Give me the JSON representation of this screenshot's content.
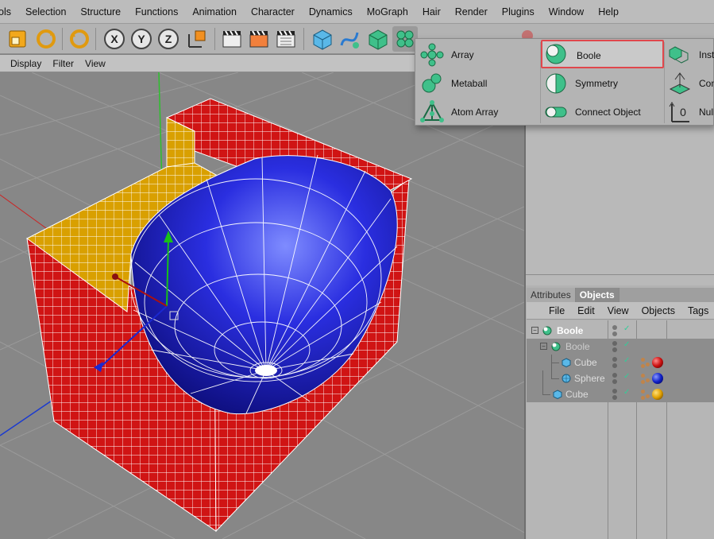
{
  "menubar": [
    "ols",
    "Selection",
    "Structure",
    "Functions",
    "Animation",
    "Character",
    "Dynamics",
    "MoGraph",
    "Hair",
    "Render",
    "Plugins",
    "Window",
    "Help"
  ],
  "viewport_menu": [
    "Display",
    "Filter",
    "View"
  ],
  "tabs": [
    {
      "label": "Attributes",
      "active": false
    },
    {
      "label": "Objects",
      "active": true
    }
  ],
  "objects_menu": [
    "File",
    "Edit",
    "View",
    "Objects",
    "Tags"
  ],
  "object_tree": [
    {
      "name": "Boole",
      "icon": "boole-icon",
      "level": 0,
      "selected": false,
      "materials": []
    },
    {
      "name": "Boole",
      "icon": "boole-icon",
      "level": 1,
      "selected": true,
      "materials": []
    },
    {
      "name": "Cube",
      "icon": "cube-icon",
      "level": 2,
      "selected": true,
      "materials": [
        "#cc1010"
      ]
    },
    {
      "name": "Sphere",
      "icon": "sphere-icon",
      "level": 2,
      "selected": true,
      "materials": [
        "#1020c8"
      ]
    },
    {
      "name": "Cube",
      "icon": "cube-icon",
      "level": 1,
      "selected": true,
      "materials": [
        "#e0a000"
      ]
    }
  ],
  "popup": {
    "items": [
      {
        "label": "Array",
        "icon": "array-icon",
        "highlighted": false
      },
      {
        "label": "Metaball",
        "icon": "metaball-icon",
        "highlighted": false
      },
      {
        "label": "Atom Array",
        "icon": "atom-array-icon",
        "highlighted": false
      },
      {
        "label": "Boole",
        "icon": "boole-icon",
        "highlighted": true
      },
      {
        "label": "Symmetry",
        "icon": "symmetry-icon",
        "highlighted": false
      },
      {
        "label": "Connect Object",
        "icon": "connect-object-icon",
        "highlighted": false
      },
      {
        "label": "Insta",
        "icon": "instance-icon",
        "highlighted": false
      },
      {
        "label": "Con",
        "icon": "construction-icon",
        "highlighted": false
      },
      {
        "label": "Null",
        "icon": "null-icon",
        "highlighted": false
      }
    ]
  },
  "colors": {
    "accent_red": "#e0474c",
    "object_green": "#3fc08a",
    "cube_red": "#cc1010",
    "cube_yellow": "#d9a000",
    "sphere_blue": "#1a1aa8"
  }
}
